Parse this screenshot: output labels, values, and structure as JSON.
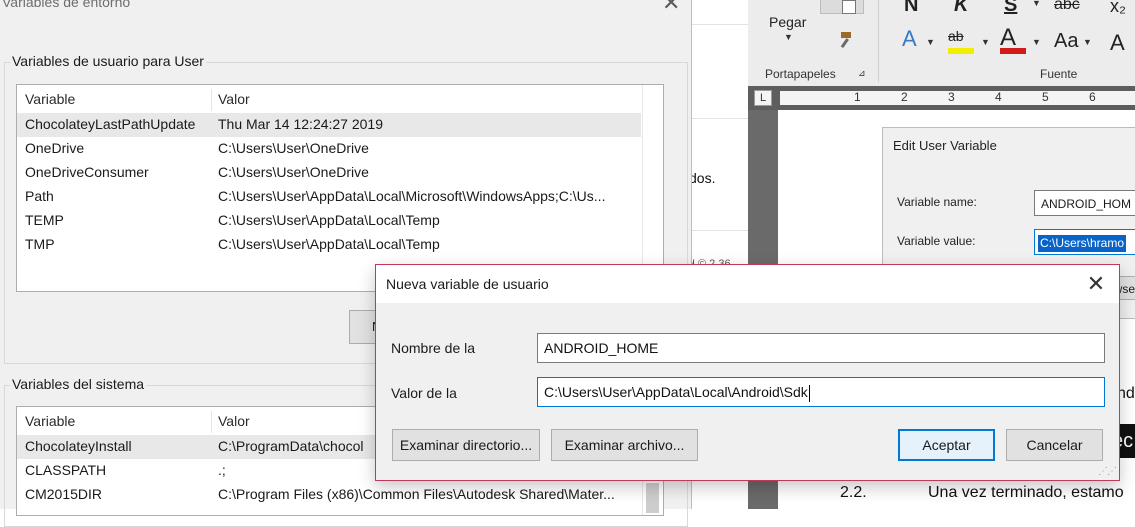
{
  "env_dialog": {
    "title": "Variables de entorno",
    "close_glyph": "✕",
    "user_section_label": "Variables de usuario para User",
    "user_columns": [
      "Variable",
      "Valor"
    ],
    "user_rows": [
      {
        "variable": "ChocolateyLastPathUpdate",
        "value": "Thu Mar 14 12:24:27 2019",
        "selected": true
      },
      {
        "variable": "OneDrive",
        "value": "C:\\Users\\User\\OneDrive",
        "selected": false
      },
      {
        "variable": "OneDriveConsumer",
        "value": "C:\\Users\\User\\OneDrive",
        "selected": false
      },
      {
        "variable": "Path",
        "value": "C:\\Users\\User\\AppData\\Local\\Microsoft\\WindowsApps;C:\\Us...",
        "selected": false
      },
      {
        "variable": "TEMP",
        "value": "C:\\Users\\User\\AppData\\Local\\Temp",
        "selected": false
      },
      {
        "variable": "TMP",
        "value": "C:\\Users\\User\\AppData\\Local\\Temp",
        "selected": false
      }
    ],
    "user_button_partial": "N",
    "system_section_label": "Variables del sistema",
    "system_columns": [
      "Variable",
      "Valor"
    ],
    "system_rows": [
      {
        "variable": "ChocolateyInstall",
        "value": "C:\\ProgramData\\chocol",
        "selected": true
      },
      {
        "variable": "CLASSPATH",
        "value": ".;",
        "selected": false
      },
      {
        "variable": "CM2015DIR",
        "value": "C:\\Program Files (x86)\\Common Files\\Autodesk Shared\\Mater...",
        "selected": false
      }
    ]
  },
  "new_var_dialog": {
    "title": "Nueva variable de usuario",
    "close_glyph": "✕",
    "name_label": "Nombre de la",
    "name_value": "ANDROID_HOME",
    "value_label": "Valor de la",
    "value_value": "C:\\Users\\User\\AppData\\Local\\Android\\Sdk",
    "browse_dir_button": "Examinar directorio...",
    "browse_file_button": "Examinar archivo...",
    "ok_button": "Aceptar",
    "cancel_button": "Cancelar"
  },
  "word": {
    "paste_label": "Pegar",
    "clipboard_label": "Portapapeles",
    "font_label": "Fuente",
    "bold_glyph": "N",
    "italic_glyph": "K",
    "underline_glyph": "S",
    "strike_glyph": "abc",
    "subscript_glyph": "x₂",
    "font_color_glyph": "A",
    "change_case_glyph": "Aa",
    "grow_font_glyph": "A",
    "ruler_corner": "L",
    "ruler_numbers": [
      "1",
      "2",
      "3",
      "4",
      "5",
      "6"
    ],
    "doc_fragment_1": "dos.",
    "doc_fragment_2": "H © 2 36",
    "doc_fragment_3": "nd",
    "doc_fragment_4": "ec",
    "section_number": "2.2.",
    "section_text": "Una vez terminado, estamo",
    "edit_dialog": {
      "title": "Edit User Variable",
      "name_label": "Variable name:",
      "name_value": "ANDROID_HOM",
      "value_label": "Variable value:",
      "value_value": "C:\\Users\\hramo",
      "browse_partial": "wse"
    }
  },
  "colors": {
    "accent": "#0078d7",
    "dialog_bg": "#f0f0f0",
    "active_border": "#c4375a",
    "highlight_yellow": "#f3ee00",
    "font_red": "#d11a1a"
  }
}
